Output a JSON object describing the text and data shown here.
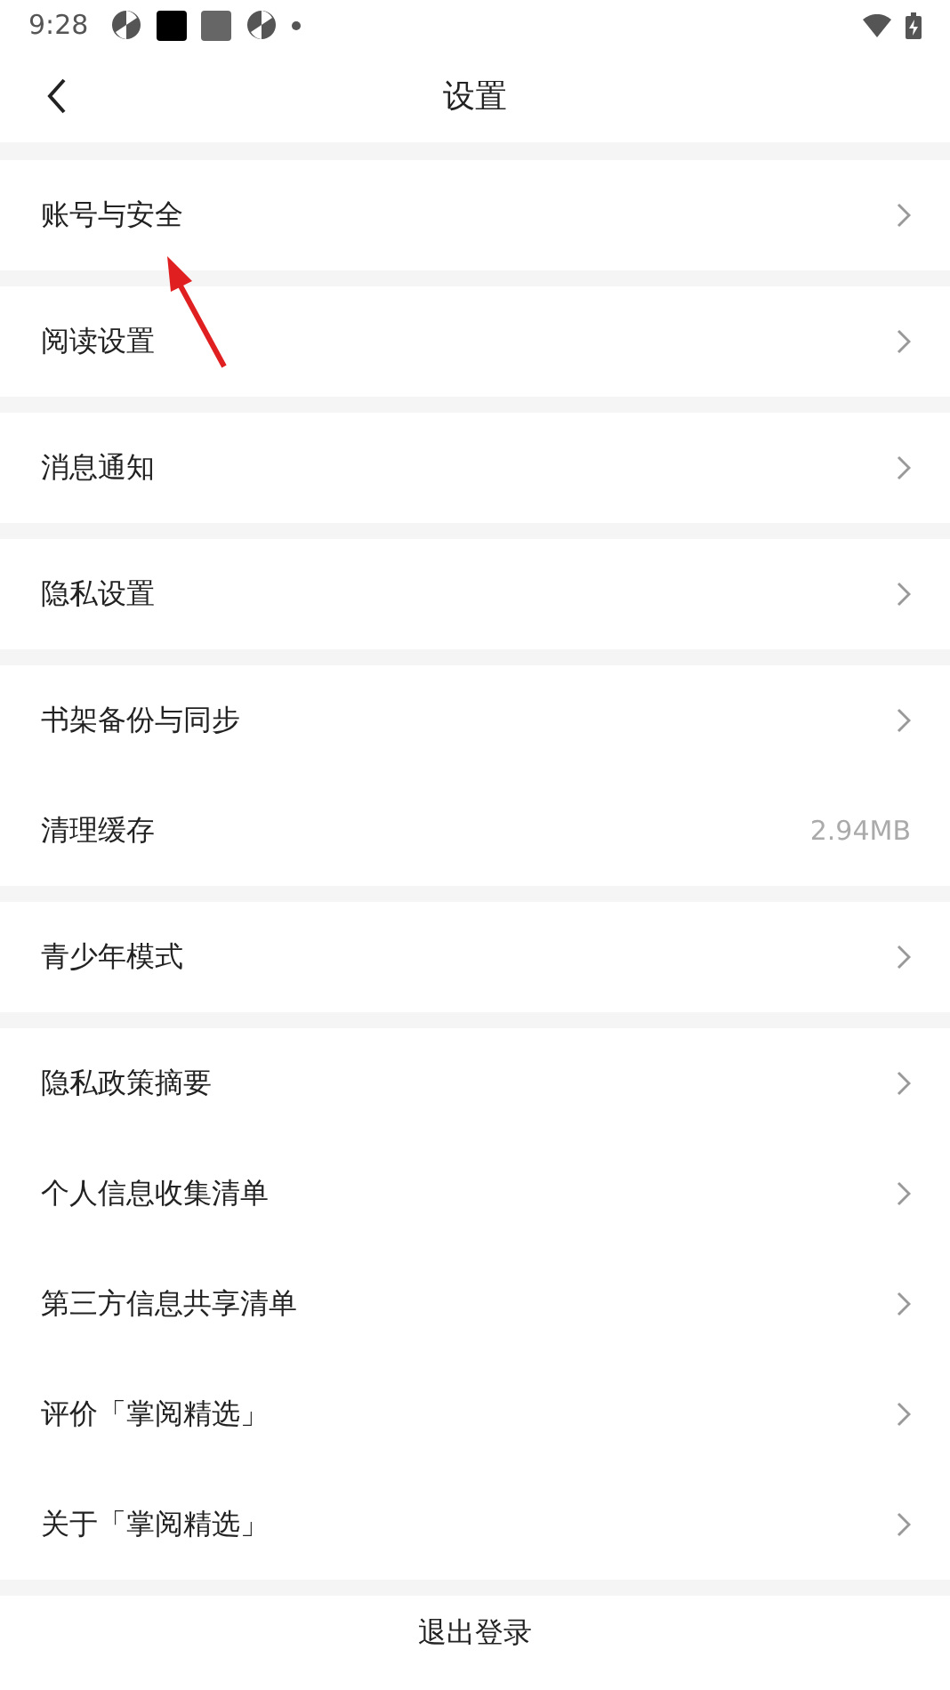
{
  "status_bar": {
    "time": "9:28"
  },
  "header": {
    "title": "设置"
  },
  "groups": [
    {
      "items": [
        {
          "label": "账号与安全",
          "kind": "link"
        }
      ]
    },
    {
      "items": [
        {
          "label": "阅读设置",
          "kind": "link"
        }
      ]
    },
    {
      "items": [
        {
          "label": "消息通知",
          "kind": "link"
        }
      ]
    },
    {
      "items": [
        {
          "label": "隐私设置",
          "kind": "link"
        }
      ]
    },
    {
      "items": [
        {
          "label": "书架备份与同步",
          "kind": "link"
        },
        {
          "label": "清理缓存",
          "kind": "value",
          "value": "2.94MB"
        }
      ]
    },
    {
      "items": [
        {
          "label": "青少年模式",
          "kind": "link"
        }
      ]
    },
    {
      "items": [
        {
          "label": "隐私政策摘要",
          "kind": "link"
        },
        {
          "label": "个人信息收集清单",
          "kind": "link"
        },
        {
          "label": "第三方信息共享清单",
          "kind": "link"
        },
        {
          "label": "评价「掌阅精选」",
          "kind": "link"
        },
        {
          "label": "关于「掌阅精选」",
          "kind": "link"
        }
      ]
    }
  ],
  "logout": {
    "label": "退出登录"
  }
}
